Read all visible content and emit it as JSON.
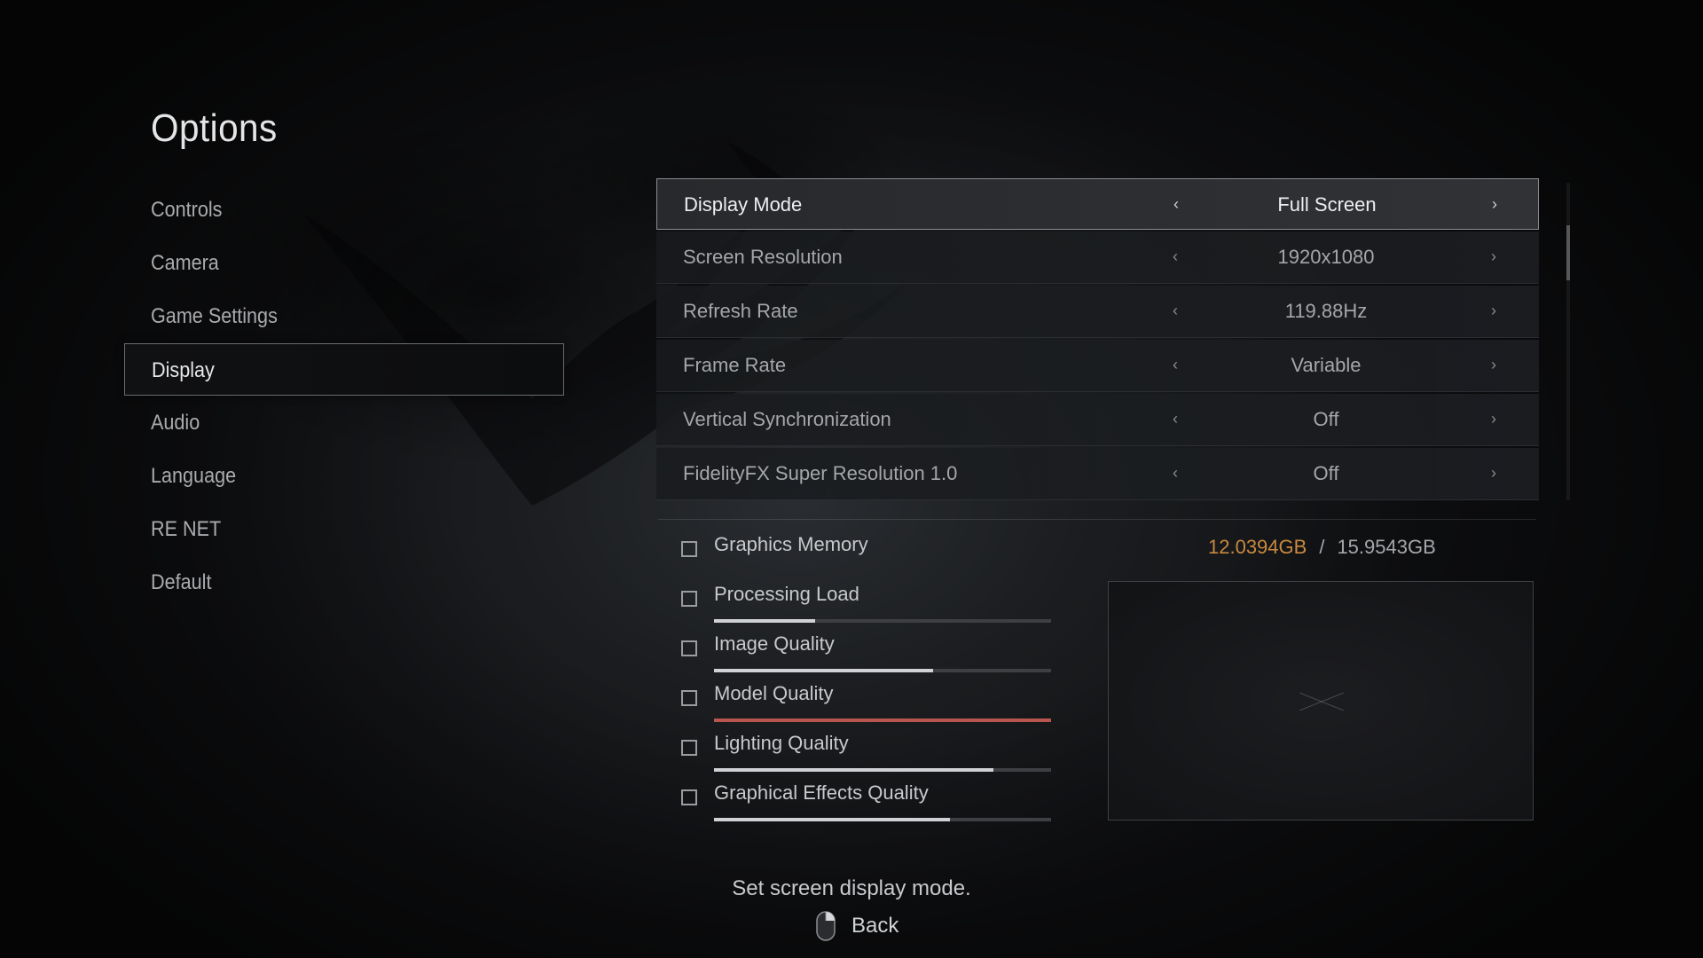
{
  "app": {
    "title": "Options"
  },
  "nav": {
    "items": [
      {
        "label": "Controls",
        "active": false
      },
      {
        "label": "Camera",
        "active": false
      },
      {
        "label": "Game Settings",
        "active": false
      },
      {
        "label": "Display",
        "active": true
      },
      {
        "label": "Audio",
        "active": false
      },
      {
        "label": "Language",
        "active": false
      },
      {
        "label": "RE NET",
        "active": false
      },
      {
        "label": "Default",
        "active": false
      }
    ]
  },
  "settings": {
    "rows": [
      {
        "label": "Display Mode",
        "value": "Full Screen",
        "active": true
      },
      {
        "label": "Screen Resolution",
        "value": "1920x1080",
        "active": false
      },
      {
        "label": "Refresh Rate",
        "value": "119.88Hz",
        "active": false
      },
      {
        "label": "Frame Rate",
        "value": "Variable",
        "active": false
      },
      {
        "label": "Vertical Synchronization",
        "value": "Off",
        "active": false
      },
      {
        "label": "FidelityFX Super Resolution 1.0",
        "value": "Off",
        "active": false
      }
    ],
    "scroll_fraction": 0.13
  },
  "performance": {
    "memory": {
      "label": "Graphics Memory",
      "used": "12.0394GB",
      "separator": "/",
      "total": "15.9543GB"
    },
    "items": [
      {
        "label": "Processing Load",
        "level": 0.3,
        "warn": false
      },
      {
        "label": "Image Quality",
        "level": 0.65,
        "warn": false
      },
      {
        "label": "Model Quality",
        "level": 1.0,
        "warn": true
      },
      {
        "label": "Lighting Quality",
        "level": 0.83,
        "warn": false
      },
      {
        "label": "Graphical Effects Quality",
        "level": 0.7,
        "warn": false
      }
    ],
    "colors": {
      "used_memory": "#c9893f",
      "warn_bar": "#b8554f",
      "bar": "#cfd1d4"
    }
  },
  "footer": {
    "help_text": "Set screen display mode.",
    "back_label": "Back",
    "back_icon": "mouse-right-click-icon"
  }
}
